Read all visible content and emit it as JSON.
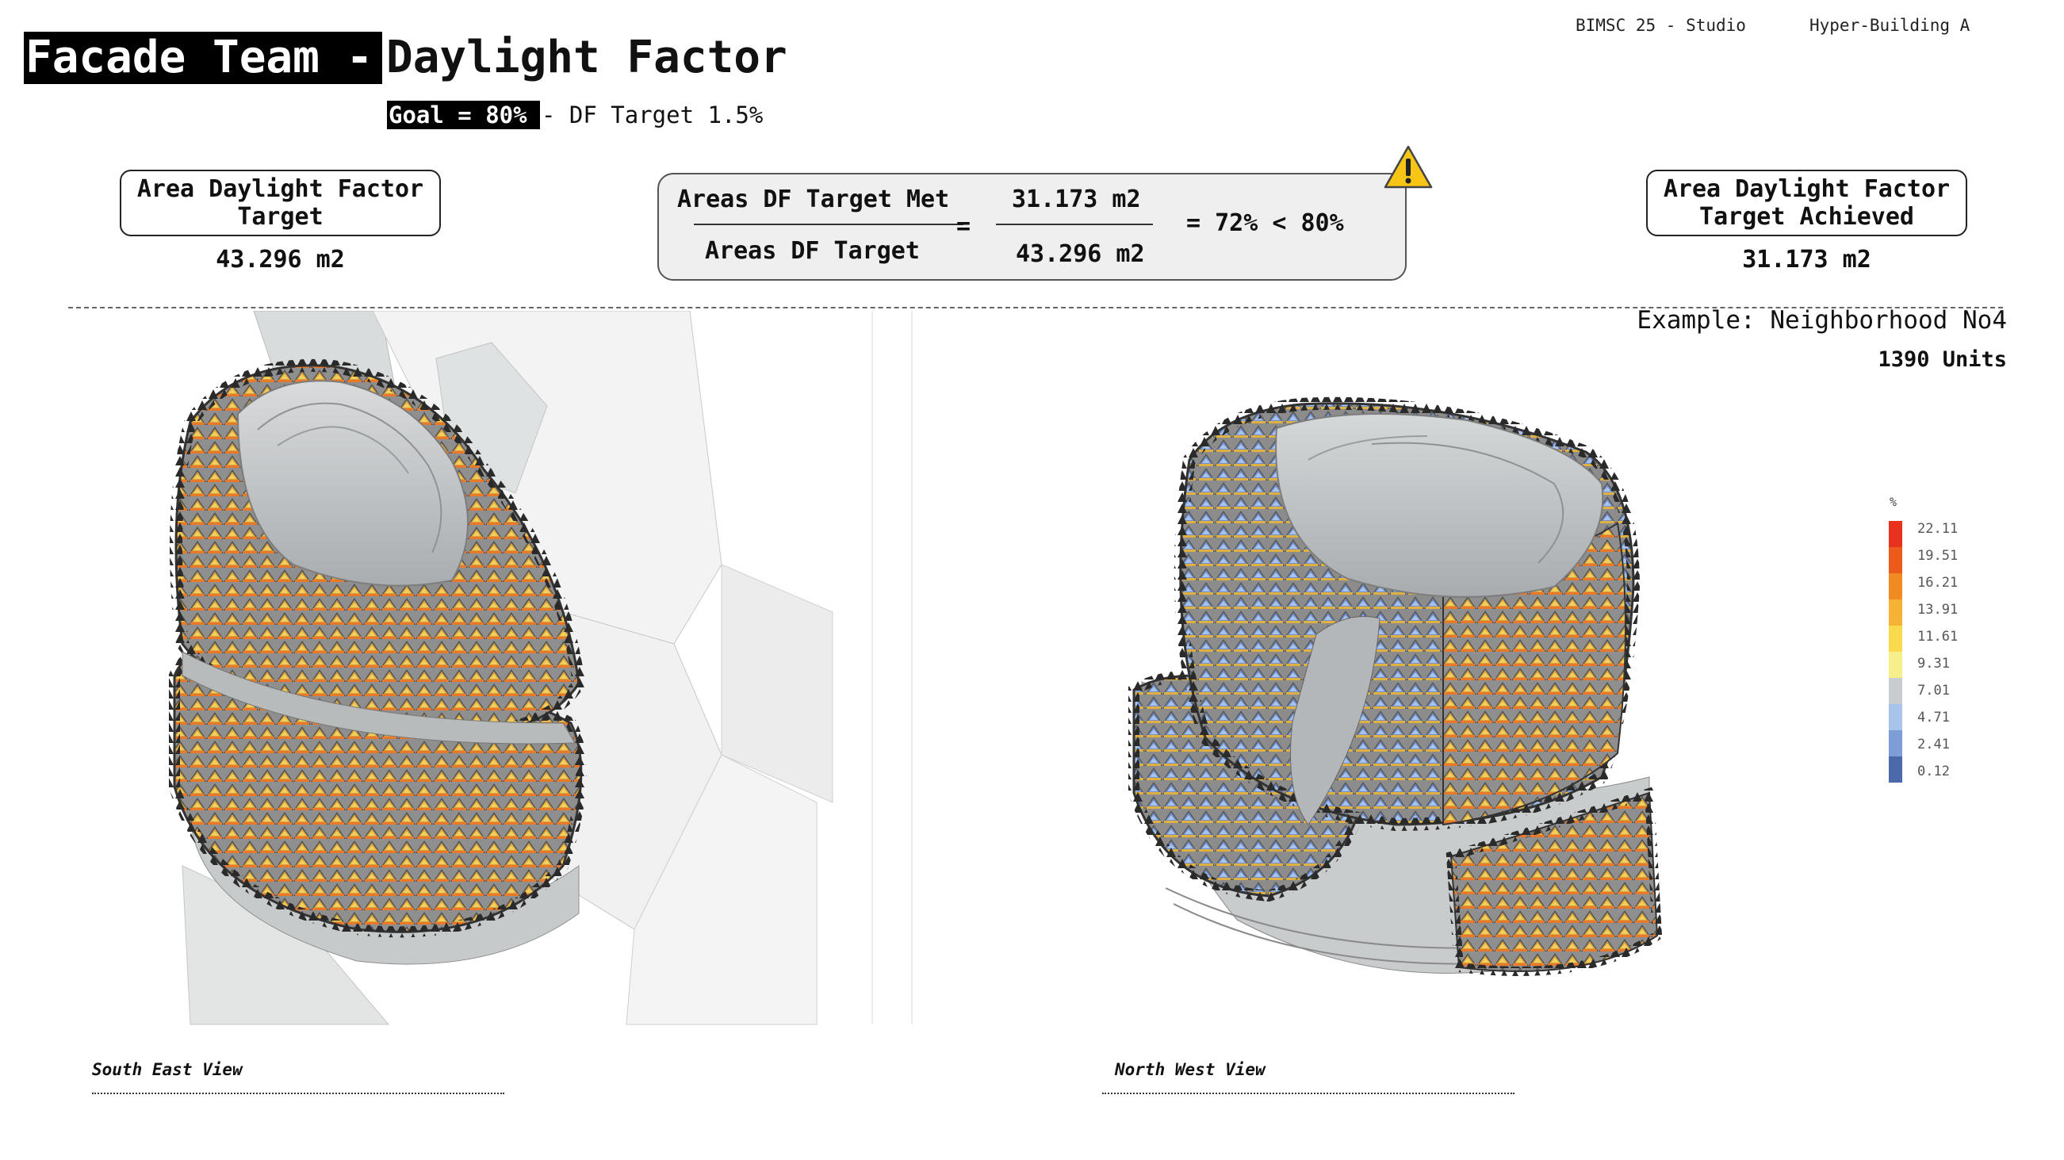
{
  "header": {
    "course": "BIMSC 25 - Studio",
    "project": "Hyper-Building A",
    "title_team": "Facade Team -",
    "title_topic": "Daylight Factor",
    "goal_label": "Goal = 80%",
    "goal_rest": "- DF Target 1.5%"
  },
  "left_box": {
    "line1": "Area Daylight Factor",
    "line2": "Target",
    "value": "43.296 m2"
  },
  "right_box": {
    "line1": "Area Daylight Factor",
    "line2": "Target Achieved",
    "value": "31.173 m2"
  },
  "calculation": {
    "numerator_label": "Areas DF Target Met",
    "denominator_label": "Areas DF Target",
    "equals": "=",
    "numerator_value": "31.173 m2",
    "denominator_value": "43.296 m2",
    "result": "= 72% < 80%",
    "warning_icon": "warning-triangle-icon"
  },
  "example": {
    "label": "Example: Neighborhood No4",
    "units": "1390 Units"
  },
  "views": {
    "left": "South East View",
    "right": "North West View"
  },
  "legend": {
    "unit": "%",
    "labels": [
      "22.11",
      "19.51",
      "16.21",
      "13.91",
      "11.61",
      "9.31",
      "7.01",
      "4.71",
      "2.41",
      "0.12"
    ],
    "colors": [
      "#e8321e",
      "#ec5a1c",
      "#f08a22",
      "#f5b235",
      "#f8da4c",
      "#f6ef8a",
      "#c8cdd2",
      "#a9c4ea",
      "#7c9dd6",
      "#4c6aaa"
    ]
  }
}
